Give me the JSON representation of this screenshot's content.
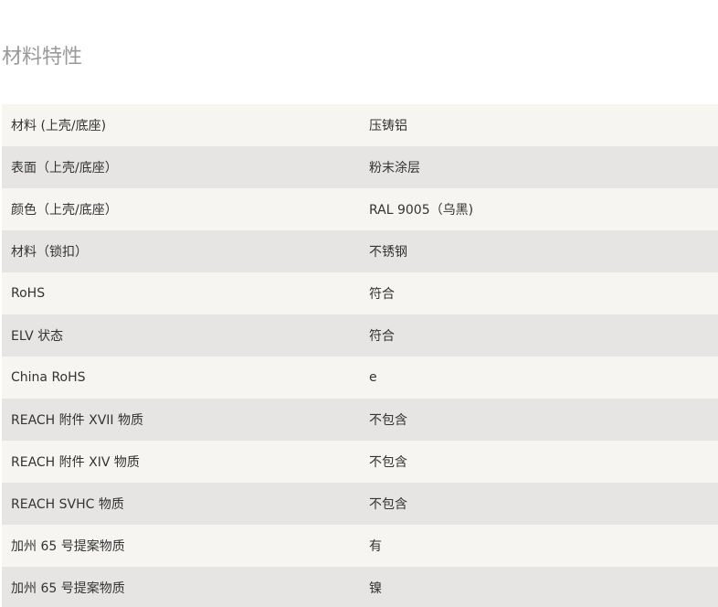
{
  "section": {
    "title": "材料特性"
  },
  "rows": [
    {
      "label": "材料 (上壳/底座)",
      "value": "压铸铝"
    },
    {
      "label": "表面（上壳/底座）",
      "value": "粉末涂层"
    },
    {
      "label": "颜色（上壳/底座）",
      "value": "RAL 9005（乌黑)"
    },
    {
      "label": "材料（锁扣）",
      "value": "不锈钢"
    },
    {
      "label": "RoHS",
      "value": "符合"
    },
    {
      "label": "ELV 状态",
      "value": "符合"
    },
    {
      "label": "China RoHS",
      "value": "e"
    },
    {
      "label": "REACH 附件 XVII 物质",
      "value": "不包含"
    },
    {
      "label": "REACH 附件 XIV 物质",
      "value": "不包含"
    },
    {
      "label": "REACH SVHC 物质",
      "value": "不包含"
    },
    {
      "label": "加州 65 号提案物质",
      "value": "有"
    },
    {
      "label": "加州 65 号提案物质",
      "value": "镍"
    }
  ]
}
